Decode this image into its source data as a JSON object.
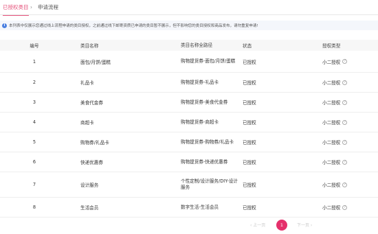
{
  "tabs": {
    "active": "已授权类目",
    "separator": "›",
    "inactive": "申请流程"
  },
  "notice": {
    "text": "本列表中仅展示您通过线上流程申请的类目授权，之前通过线下邮寄资质已申请的类目暂不展示，但不影响您的类目授权和商品发布，请勿重复申请!"
  },
  "table": {
    "headers": {
      "no": "编号",
      "name": "类目名称",
      "path": "类目名称全路径",
      "status": "状态",
      "type": "授权类型"
    },
    "rows": [
      {
        "no": "1",
        "name": "面包/月饼/蛋糕",
        "path": "购物提货券-面包/月饼/蛋糕",
        "status": "已授权",
        "type": "小二授权"
      },
      {
        "no": "2",
        "name": "礼品卡",
        "path": "购物提货券-礼品卡",
        "status": "已授权",
        "type": "小二授权"
      },
      {
        "no": "3",
        "name": "美食代金券",
        "path": "购物提货券-美食代金券",
        "status": "已授权",
        "type": "小二授权"
      },
      {
        "no": "4",
        "name": "商超卡",
        "path": "购物提货券-商超卡",
        "status": "已授权",
        "type": "小二授权"
      },
      {
        "no": "5",
        "name": "购物券/礼品卡",
        "path": "购物提货券-购物券/礼品卡",
        "status": "已授权",
        "type": "小二授权"
      },
      {
        "no": "6",
        "name": "快递优惠券",
        "path": "购物提货券-快递优惠券",
        "status": "已授权",
        "type": "小二授权"
      },
      {
        "no": "7",
        "name": "设计服务",
        "path": "个性定制/设计服务/DIY-设计服务",
        "status": "已授权",
        "type": "小二授权"
      },
      {
        "no": "8",
        "name": "生活会员",
        "path": "数字生活-生活会员",
        "status": "已授权",
        "type": "小二授权"
      }
    ],
    "help_glyph": "?"
  },
  "pagination": {
    "prev": "‹ 上一页",
    "current": "1",
    "next": "下一页 ›"
  },
  "colors": {
    "accent": "#e5527b",
    "page_active": "#e5306b",
    "info": "#4a7fe0"
  }
}
